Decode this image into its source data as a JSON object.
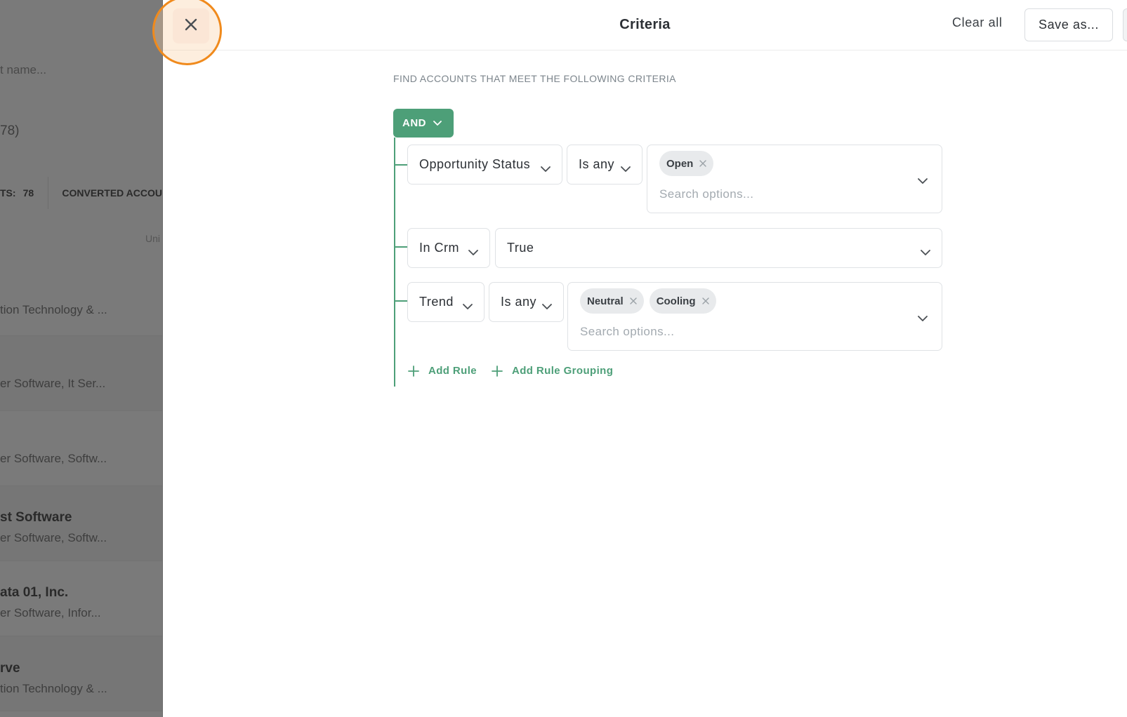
{
  "background": {
    "search_fragment": "t name...",
    "count_fragment": "78)",
    "tabs": {
      "count_label": "TS:",
      "count_value": "78",
      "converted_label": "CONVERTED ACCOU"
    },
    "column_header_fragment": "Uni",
    "rows": [
      {
        "name": "",
        "sub": "tion Technology & ..."
      },
      {
        "name": "",
        "sub": "er Software, It Ser..."
      },
      {
        "name": "",
        "sub": "er Software, Softw..."
      },
      {
        "name": "st Software",
        "sub": "er Software, Softw..."
      },
      {
        "name": "ata 01, Inc.",
        "sub": "er Software, Infor..."
      },
      {
        "name": "rve",
        "sub": "tion Technology & ..."
      }
    ]
  },
  "header": {
    "title": "Criteria",
    "clear_all": "Clear all",
    "save_as": "Save as..."
  },
  "criteria": {
    "heading": "FIND ACCOUNTS THAT MEET THE FOLLOWING CRITERIA",
    "group_operator": "AND",
    "rules": [
      {
        "field": "Opportunity Status",
        "operator": "Is any",
        "values": [
          "Open"
        ],
        "placeholder": "Search options..."
      },
      {
        "field": "In Crm",
        "value": "True"
      },
      {
        "field": "Trend",
        "operator": "Is any",
        "values": [
          "Neutral",
          "Cooling"
        ],
        "placeholder": "Search options..."
      }
    ],
    "add_rule": "Add Rule",
    "add_rule_grouping": "Add Rule Grouping"
  },
  "colors": {
    "accent": "#4d9f78",
    "highlight_ring": "#f08a1c",
    "overlay": "#7a7a7a"
  },
  "icons": {
    "close": "close-icon",
    "chevron": "chevron-down-icon",
    "chip_remove": "x-icon",
    "add": "plus-icon"
  }
}
